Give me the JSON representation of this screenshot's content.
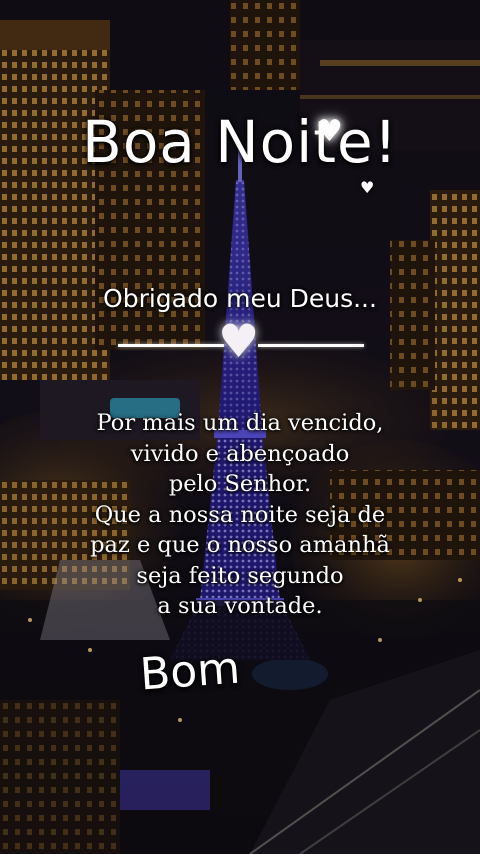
{
  "greeting": {
    "title": "Boa Noite!",
    "subtitle": "Obrigado meu Deus...",
    "message_lines": [
      "Por mais um dia vencido,",
      "vivido e abençoado",
      "pelo Senhor.",
      "Que a nossa noite seja de",
      "paz e que o nosso amanhã",
      "seja feito segundo",
      "a sua vontade."
    ],
    "closing": "Bom"
  },
  "icons": {
    "sparkle_heart": "♥",
    "small_heart": "♥",
    "divider_heart": "♥"
  },
  "colors": {
    "text": "#ffffff",
    "tower_light": "#4a3fd6",
    "city_glow": "#d99a3a",
    "sky": "#0a0812"
  }
}
